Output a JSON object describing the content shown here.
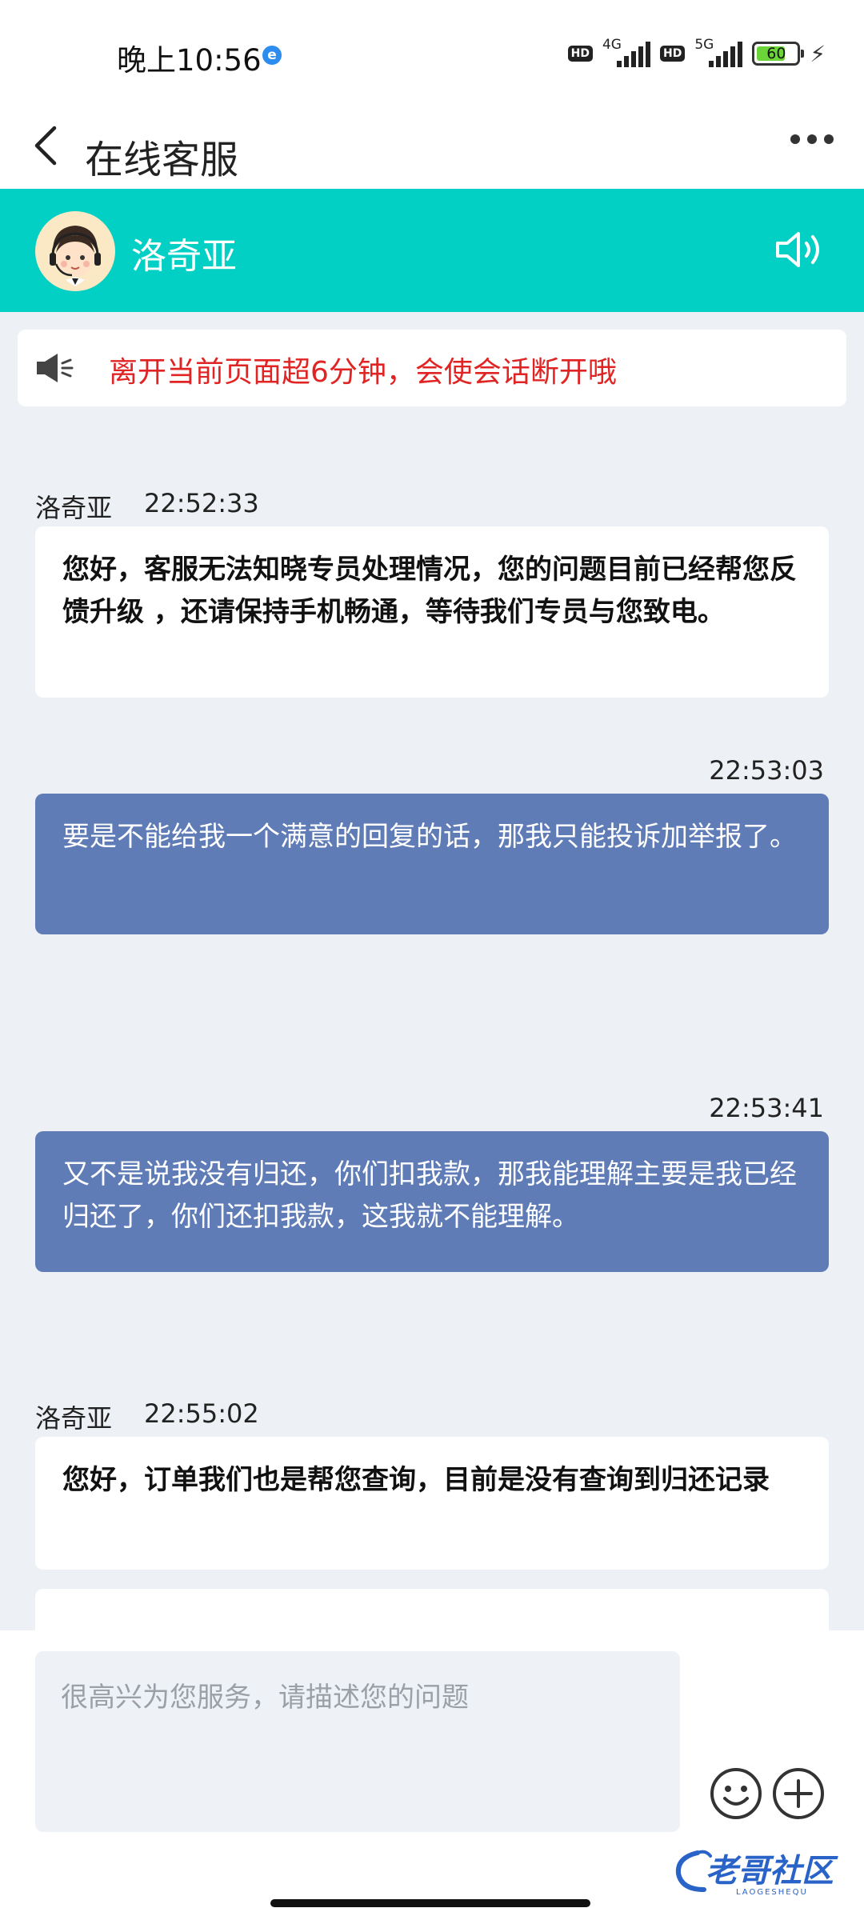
{
  "status_bar": {
    "time": "晚上10:56",
    "browser_badge": "e",
    "sim1": {
      "hd": "HD",
      "network": "4G"
    },
    "sim2": {
      "hd": "HD",
      "network": "5G"
    },
    "battery": "60"
  },
  "nav": {
    "title": "在线客服"
  },
  "agent": {
    "name": "洛奇亚"
  },
  "notice": {
    "text": "离开当前页面超6分钟，会使会话断开哦"
  },
  "messages": [
    {
      "sender": "洛奇亚",
      "time": "22:52:33",
      "role": "agent",
      "text": "您好，客服无法知晓专员处理情况，您的问题目前已经帮您反馈升级 ，还请保持手机畅通，等待我们专员与您致电。"
    },
    {
      "sender": "",
      "time": "22:53:03",
      "role": "user",
      "text": "要是不能给我一个满意的回复的话，那我只能投诉加举报了。"
    },
    {
      "sender": "",
      "time": "22:53:41",
      "role": "user",
      "text": "又不是说我没有归还，你们扣我款，那我能理解主要是我已经归还了，你们还扣我款，这我就不能理解。"
    },
    {
      "sender": "洛奇亚",
      "time": "22:55:02",
      "role": "agent",
      "text": "您好，订单我们也是帮您查询，目前是没有查询到归还记录"
    }
  ],
  "input": {
    "placeholder": "很高兴为您服务，请描述您的问题"
  },
  "watermark": {
    "text": "老哥社区",
    "subtext": "LAOGESHEQU"
  },
  "colors": {
    "accent_teal": "#03d0c5",
    "user_bubble": "#5f7cb6",
    "notice_red": "#e02424",
    "chat_bg": "#edf0f4"
  }
}
